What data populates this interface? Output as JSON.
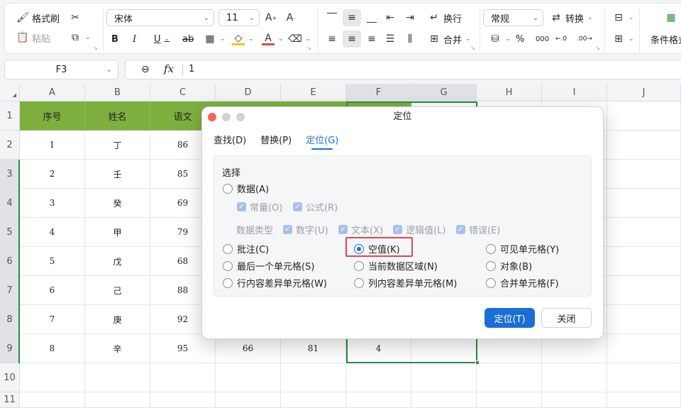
{
  "ribbon": {
    "format_painter": "格式刷",
    "paste": "粘贴",
    "font_name": "宋体",
    "font_size": "11",
    "wrap": "换行",
    "merge": "合并",
    "number_format": "常规",
    "convert": "转换",
    "conditional_format": "条件格式",
    "bold": "B",
    "italic": "I",
    "underline": "U",
    "strike": "ab",
    "percent": "%",
    "thousands": "000",
    "inc_decimal": "←.0",
    "dec_decimal": ".00→"
  },
  "formula_bar": {
    "name_box": "F3",
    "fx_label": "fx",
    "value": "1"
  },
  "grid": {
    "columns": [
      "A",
      "B",
      "C",
      "D",
      "E",
      "F",
      "G",
      "H",
      "I",
      "J"
    ],
    "rows": [
      "1",
      "2",
      "3",
      "4",
      "5",
      "6",
      "7",
      "8",
      "9",
      "10",
      "11"
    ],
    "header": {
      "a": "序号",
      "b": "姓名",
      "c": "语文"
    },
    "data": [
      {
        "a": "1",
        "b": "丁",
        "c": "86"
      },
      {
        "a": "2",
        "b": "壬",
        "c": "85"
      },
      {
        "a": "3",
        "b": "癸",
        "c": "69"
      },
      {
        "a": "4",
        "b": "甲",
        "c": "79"
      },
      {
        "a": "5",
        "b": "戊",
        "c": "68"
      },
      {
        "a": "6",
        "b": "己",
        "c": "88"
      },
      {
        "a": "7",
        "b": "庚",
        "c": "92"
      },
      {
        "a": "8",
        "b": "辛",
        "c": "95"
      }
    ],
    "row9_extra": {
      "d": "66",
      "e": "81",
      "f": "4"
    }
  },
  "dialog": {
    "title": "定位",
    "tabs": [
      "查找(D)",
      "替换(P)",
      "定位(G)"
    ],
    "active_tab": "定位(G)",
    "section_label": "选择",
    "data_radio": "数据(A)",
    "constants": "常量(O)",
    "formulas": "公式(R)",
    "data_type_label": "数据类型",
    "type_number": "数字(U)",
    "type_text": "文本(X)",
    "type_logical": "逻辑值(L)",
    "type_error": "错误(E)",
    "opt_comment": "批注(C)",
    "opt_blank": "空值(K)",
    "opt_visible": "可见单元格(Y)",
    "opt_last_cell": "最后一个单元格(S)",
    "opt_current_region": "当前数据区域(N)",
    "opt_objects": "对象(B)",
    "opt_row_diff": "行内容差异单元格(W)",
    "opt_col_diff": "列内容差异单元格(M)",
    "opt_merged": "合并单元格(F)",
    "selected_option": "空值(K)",
    "ok_button": "定位(T)",
    "close_button": "关闭"
  },
  "colors": {
    "header_fill": "#7fb03f",
    "accent": "#1a6fd6",
    "selection": "#2e8b45",
    "highlight": "#e0474c",
    "traffic_close": "#ff5f57"
  }
}
